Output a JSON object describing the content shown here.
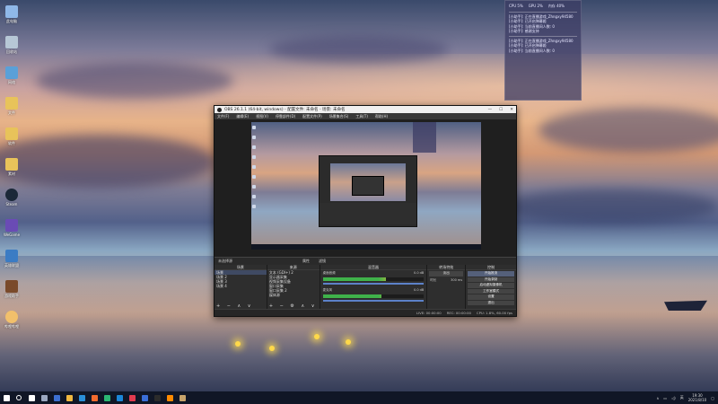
{
  "desktop": {
    "icons": [
      {
        "label": "此电脑",
        "color": "#8fb8e8"
      },
      {
        "label": "回收站",
        "color": "#b7c7d6"
      },
      {
        "label": "网络",
        "color": "#5aa0d8"
      },
      {
        "label": "文件",
        "color": "#e8c35a"
      },
      {
        "label": "软件",
        "color": "#e8c35a"
      },
      {
        "label": "素材",
        "color": "#e8c35a"
      },
      {
        "label": "Steam",
        "color": "#1b2838"
      },
      {
        "label": "WeGame",
        "color": "#6a4bb5"
      },
      {
        "label": "英雄联盟",
        "color": "#3b7cc4"
      },
      {
        "label": "游戏助手",
        "color": "#7a4a2a"
      },
      {
        "label": "哔哩哔哩",
        "color": "#f2c06b"
      }
    ]
  },
  "widget": {
    "stats": [
      "CPU 5%",
      "GPU 2%",
      "内存 40%"
    ],
    "rows": [
      "[小助手]: 正在直播游戏_Zhngxy94580",
      "[小助手]: 已开启弹幕姬",
      "[小助手]: 当前直播间人数: 0",
      "[小助手]: 感谢支持"
    ],
    "rows2": [
      "[小助手]: 正在直播游戏_Zhngxy94580",
      "[小助手]: 已开启弹幕姬",
      "[小助手]: 当前直播间人数: 0"
    ]
  },
  "obs": {
    "title": "OBS 26.1.1 (64-bit, windows) - 配置文件: 未命名 - 场景: 未命名",
    "window_controls": [
      "—",
      "☐",
      "✕"
    ],
    "menu": [
      "文件(F)",
      "编辑(E)",
      "视图(V)",
      "停靠部件(D)",
      "配置文件(P)",
      "场景集合(S)",
      "工具(T)",
      "帮助(H)"
    ],
    "scenebar": {
      "label": "未选择源",
      "buttons": [
        "属性",
        "滤镜"
      ]
    },
    "scenes": {
      "header": "场景",
      "items": [
        "场景",
        "场景 2",
        "场景 3",
        "场景 4"
      ],
      "selected": 0
    },
    "sources": {
      "header": "来源",
      "items": [
        "文本 (GDI+) 2",
        "显示器采集",
        "视频采集设备",
        "窗口采集",
        "窗口采集 2",
        "媒体源"
      ]
    },
    "mixer": {
      "header": "混音器",
      "channels": [
        {
          "name": "桌面音频",
          "db": "0.0 dB",
          "level": 0.62
        },
        {
          "name": "麦克风",
          "db": "0.0 dB",
          "level": 0.58
        }
      ]
    },
    "transitions": {
      "header": "转场特效",
      "type": "淡出",
      "duration_label": "时长",
      "duration": "300 ms"
    },
    "controls": {
      "header": "控制",
      "buttons": [
        "开始推流",
        "开始录制",
        "启动虚拟摄像机",
        "工作室模式",
        "设置",
        "退出"
      ],
      "highlight": 0
    },
    "status": [
      "LIVE: 00:00:00",
      "REC: 00:00:00",
      "CPU: 1.8%, 60.00 fps"
    ]
  },
  "taskbar": {
    "time": "19:30",
    "date": "2021/8/10",
    "lang": "英",
    "app_colors": [
      "#ffffff",
      "#9aa7c0",
      "#3c6fd0",
      "#f0b840",
      "#2a8fd8",
      "#f26b2e",
      "#2bb673",
      "#1b86d8",
      "#e23b4f",
      "#3a6ed8",
      "#2b2b2b",
      "#ff8a00",
      "#c7a36b"
    ]
  }
}
